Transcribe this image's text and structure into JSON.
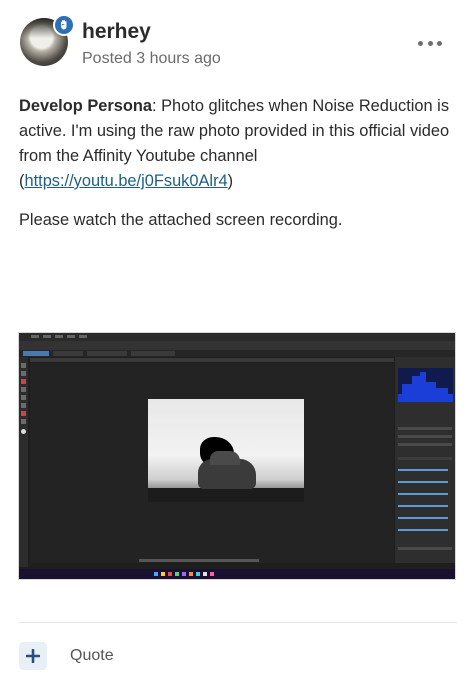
{
  "post": {
    "username": "herhey",
    "posted": "Posted 3 hours ago",
    "body": {
      "lead_bold": "Develop Persona",
      "lead_rest": ": Photo glitches when Noise Reduction is active. I'm using the raw photo provided in this official video from the Affinity Youtube channel (",
      "link_text": "https://youtu.be/j0Fsuk0Alr4",
      "lead_close": ")",
      "second": "Please watch the attached screen recording."
    },
    "attachment": "screen-recording-thumbnail"
  },
  "actions": {
    "quote_label": "Quote"
  },
  "icons": {
    "badge": "moderator-badge-icon",
    "more": "more-options-icon",
    "add": "plus-icon"
  },
  "colors": {
    "badge": "#2f6fb4",
    "link": "#1f5f86",
    "quote_plus_bg": "#e8eff7"
  }
}
